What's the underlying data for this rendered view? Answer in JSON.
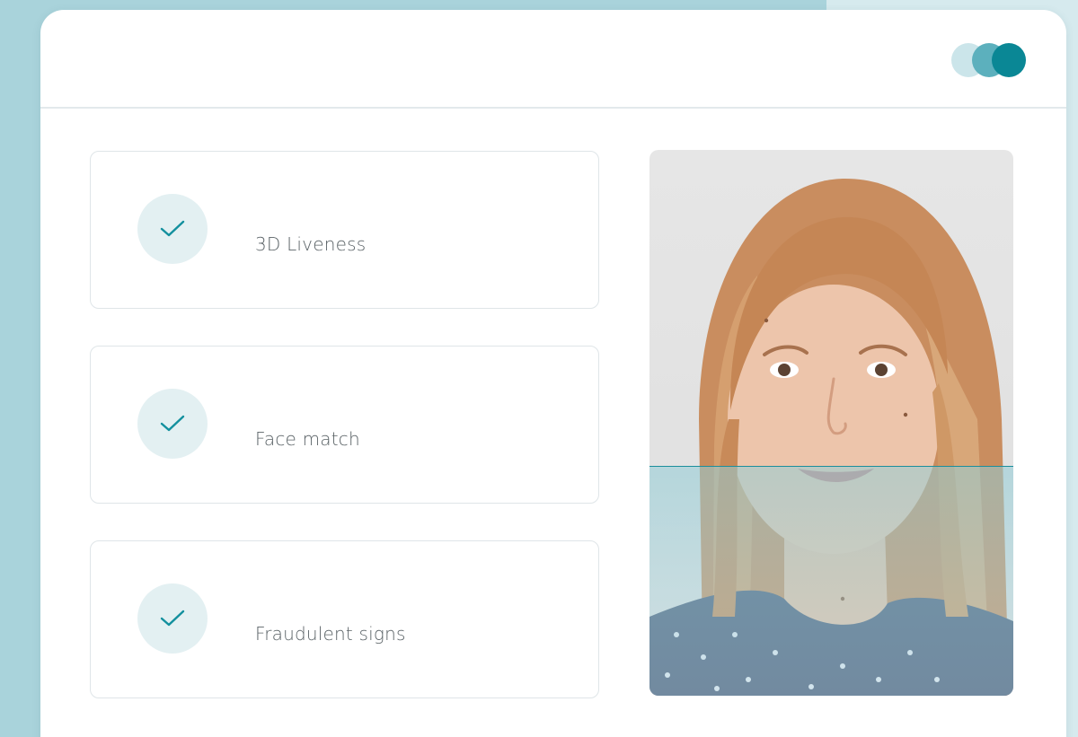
{
  "header": {
    "brand_dots": [
      "light-teal",
      "mid-teal",
      "dark-teal"
    ],
    "colors": {
      "dot_light": "#cbe5ea",
      "dot_mid": "#5cb0bd",
      "dot_dark": "#0a8795"
    }
  },
  "checks": [
    {
      "label": "3D Liveness",
      "status": "passed",
      "icon": "check-icon"
    },
    {
      "label": "Face match",
      "status": "passed",
      "icon": "check-icon"
    },
    {
      "label": "Fraudulent signs",
      "status": "passed",
      "icon": "check-icon"
    }
  ],
  "portrait": {
    "scan_progress": 0.58,
    "accent_color": "#1b8e9c"
  }
}
